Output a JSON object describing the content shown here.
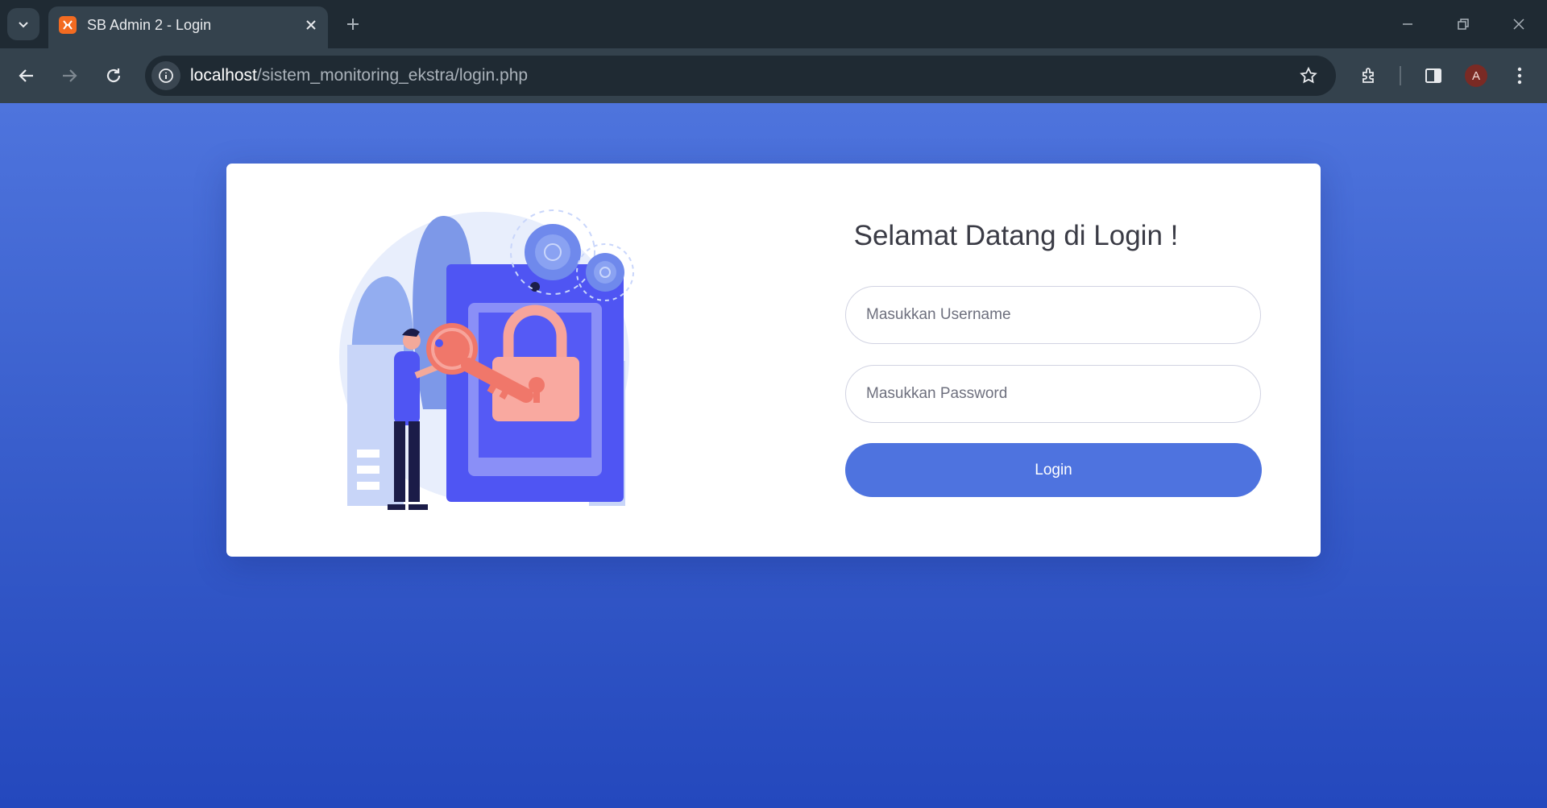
{
  "browser": {
    "tab_title": "SB Admin 2 - Login",
    "url_host": "localhost",
    "url_path": "/sistem_monitoring_ekstra/login.php",
    "profile_initial": "A",
    "favicon_icon": "xampp-icon"
  },
  "login": {
    "heading": "Selamat Datang di Login !",
    "username_placeholder": "Masukkan Username",
    "password_placeholder": "Masukkan Password",
    "button_label": "Login"
  },
  "colors": {
    "page_bg": "#4e73df",
    "button": "#4e73df",
    "illustration_accent": "#f0776a"
  }
}
